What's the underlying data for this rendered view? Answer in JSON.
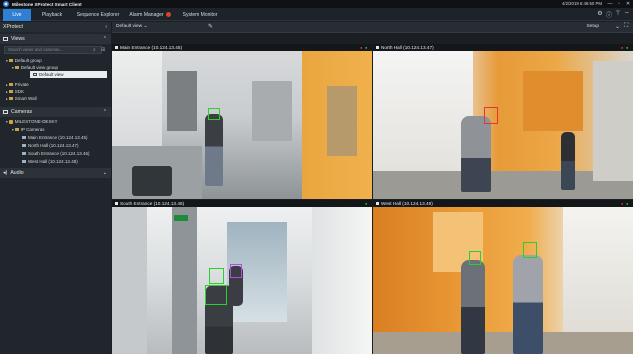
{
  "window": {
    "title": "Milestone XProtect Smart Client",
    "datetime": "4/2/2019 6:46:50 PM",
    "controls": [
      "—",
      "▫",
      "✕"
    ]
  },
  "tabs": [
    {
      "label": "Live",
      "active": true
    },
    {
      "label": "Playback",
      "active": false
    },
    {
      "label": "Sequence Explorer",
      "active": false
    },
    {
      "label": "Alarm Manager",
      "active": false
    },
    {
      "label": "System Monitor",
      "active": false
    }
  ],
  "top_icons": [
    "gear-icon",
    "info-icon",
    "pin-icon",
    "expand-icon"
  ],
  "sidebar": {
    "header": "XProtect",
    "collapse_glyph": "‹",
    "views_section": "Views",
    "search_placeholder": "Search views and cameras...",
    "view_tree": [
      {
        "label": "Default group",
        "kind": "folder",
        "indent": 0
      },
      {
        "label": "Default view group",
        "kind": "folder",
        "indent": 1
      },
      {
        "label": "Default view",
        "kind": "view",
        "indent": 2,
        "selected": true
      },
      {
        "label": "Private",
        "kind": "folder",
        "indent": 0
      },
      {
        "label": "SDK",
        "kind": "folder",
        "indent": 0
      },
      {
        "label": "Smart Wall",
        "kind": "folder",
        "indent": 0
      }
    ],
    "cameras_section": "Cameras",
    "camera_tree": [
      {
        "label": "MILESTONE-DESKY",
        "kind": "server",
        "indent": 0
      },
      {
        "label": "IP Cameras",
        "kind": "folder",
        "indent": 1
      },
      {
        "label": "Main Entrance (10.124.13.45)",
        "kind": "camera",
        "indent": 2
      },
      {
        "label": "North Hall (10.124.13.47)",
        "kind": "camera",
        "indent": 2
      },
      {
        "label": "South Entrance (10.124.13.46)",
        "kind": "camera",
        "indent": 2
      },
      {
        "label": "West Hall (10.124.13.48)",
        "kind": "camera",
        "indent": 2
      }
    ],
    "audio_section": "Audio"
  },
  "toolbar": {
    "view_selector": "Default view",
    "setup_label": "Setup"
  },
  "cameras": [
    {
      "title": "Main Entrance  (10.124.13.45)",
      "palette": "hall"
    },
    {
      "title": "North Hall  (10.124.13.47)",
      "palette": "orange"
    },
    {
      "title": "South Entrance  (10.124.13.46)",
      "palette": "glass"
    },
    {
      "title": "West Hall  (10.124.13.49)",
      "palette": "orange2"
    }
  ],
  "colors": {
    "accent": "#2f7fd3",
    "detection_box": "#2bd12b",
    "alert_box": "#e23a2a",
    "recording": "#e23a2a",
    "live": "#2bd12b"
  }
}
